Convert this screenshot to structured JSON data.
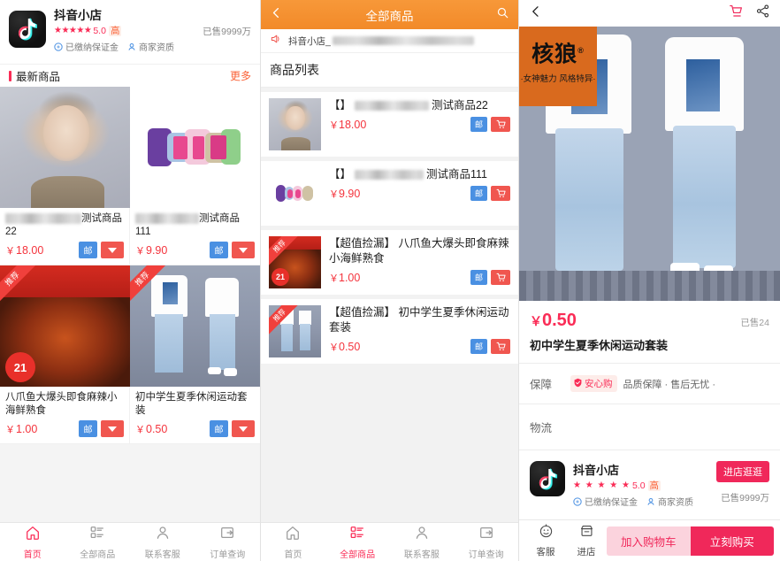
{
  "left_panel": {
    "shop": {
      "logo_icon": "tiktok-note-icon",
      "name": "抖音小店",
      "stars": "★★★★★",
      "rating": "5.0",
      "rating_tag": "高",
      "deposit_badge": "已缴纳保证金",
      "qualification_badge": "商家资质",
      "sold_count": "已售9999万"
    },
    "section": {
      "title": "最新商品",
      "more_label": "更多"
    },
    "products": [
      {
        "thumb": "anime-girl-artwork",
        "name_blurred": true,
        "name": "测试商品22",
        "price": "18.00",
        "currency": "￥",
        "post_badge": "邮",
        "recommended": false
      },
      {
        "thumb": "kk-logo-artwork",
        "name_blurred": true,
        "name": "测试商品111",
        "price": "9.90",
        "currency": "￥",
        "post_badge": "邮",
        "recommended": false
      },
      {
        "thumb": "octopus-food-photo",
        "name_blurred": false,
        "name": "八爪鱼大爆头即食麻辣小海鲜熟食",
        "price": "1.00",
        "currency": "￥",
        "post_badge": "邮",
        "recommended": true,
        "reco_label": "推荐"
      },
      {
        "thumb": "clothing-set-photo",
        "name_blurred": false,
        "name": "初中学生夏季休闲运动套装",
        "price": "0.50",
        "currency": "￥",
        "post_badge": "邮",
        "recommended": true,
        "reco_label": "推荐"
      }
    ],
    "tabs": [
      {
        "label": "首页",
        "icon": "home-icon",
        "active": true
      },
      {
        "label": "全部商品",
        "icon": "grid-list-icon",
        "active": false
      },
      {
        "label": "联系客服",
        "icon": "user-icon",
        "active": false
      },
      {
        "label": "订单查询",
        "icon": "order-lookup-icon",
        "active": false
      }
    ]
  },
  "mid_panel": {
    "topbar": {
      "back_icon": "chevron-left-icon",
      "title": "全部商品",
      "search_icon": "search-icon"
    },
    "notice": {
      "icon": "speaker-icon",
      "text": "抖音小店_"
    },
    "list_title": "商品列表",
    "items": [
      {
        "thumb": "anime-girl-artwork",
        "prefix": "【】",
        "name_blurred": true,
        "name": "测试商品22",
        "price": "18.00",
        "currency": "￥",
        "post_badge": "邮",
        "cart_icon": "cart-icon",
        "recommended": false
      },
      {
        "thumb": "kk-logo-artwork",
        "prefix": "【】",
        "name_blurred": true,
        "name": "测试商品111",
        "price": "9.90",
        "currency": "￥",
        "post_badge": "邮",
        "cart_icon": "cart-icon",
        "recommended": false
      },
      {
        "thumb": "octopus-food-photo",
        "prefix": "",
        "name_blurred": false,
        "name": "【超值捡漏】 八爪鱼大爆头即食麻辣小海鲜熟食",
        "price": "1.00",
        "currency": "￥",
        "post_badge": "邮",
        "cart_icon": "cart-icon",
        "recommended": true,
        "reco_label": "推荐"
      },
      {
        "thumb": "clothing-set-photo",
        "prefix": "",
        "name_blurred": false,
        "name": "【超值捡漏】 初中学生夏季休闲运动套装",
        "price": "0.50",
        "currency": "￥",
        "post_badge": "邮",
        "cart_icon": "cart-icon",
        "recommended": true,
        "reco_label": "推荐"
      }
    ],
    "tabs": [
      {
        "label": "首页",
        "icon": "home-icon",
        "active": false
      },
      {
        "label": "全部商品",
        "icon": "grid-list-icon",
        "active": true
      },
      {
        "label": "联系客服",
        "icon": "user-icon",
        "active": false
      },
      {
        "label": "订单查询",
        "icon": "order-lookup-icon",
        "active": false
      }
    ]
  },
  "right_panel": {
    "topbar": {
      "back_icon": "chevron-left-icon",
      "cart_icon": "cart-icon",
      "share_icon": "share-icon"
    },
    "hero": {
      "brand_word": "核狼",
      "brand_reg": "®",
      "brand_slogan": "·女神魅力 风格特异·",
      "image_desc": "clothing-set-model-photo"
    },
    "price": "0.50",
    "currency": "￥",
    "sold_text": "已售24",
    "product_name": "初中学生夏季休闲运动套装",
    "guarantee": {
      "label": "保障",
      "tag_icon": "shield-icon",
      "tag_text": "安心购",
      "desc": "品质保障 · 售后无忧 ·"
    },
    "logistics": {
      "label": "物流"
    },
    "shop": {
      "logo_icon": "tiktok-note-icon",
      "name": "抖音小店",
      "stars": "★ ★ ★ ★ ★",
      "rating": "5.0",
      "rating_tag": "高",
      "deposit_badge": "已缴纳保证金",
      "qualification_badge": "商家资质",
      "visit_button": "进店逛逛",
      "sold_count": "已售9999万"
    },
    "bottombar": {
      "service_label": "客服",
      "service_icon": "headset-icon",
      "store_label": "进店",
      "store_icon": "store-icon",
      "add_cart_label": "加入购物车",
      "buy_now_label": "立刻购买"
    }
  },
  "colors": {
    "brand_pink": "#fa2c56",
    "orange_header": "#f28a29",
    "price_red": "#f4333c",
    "blue_badge": "#4a90e2",
    "red_badge": "#f0564f",
    "buy_red": "#f0285a",
    "addcart_pink": "#fbd3dd"
  }
}
